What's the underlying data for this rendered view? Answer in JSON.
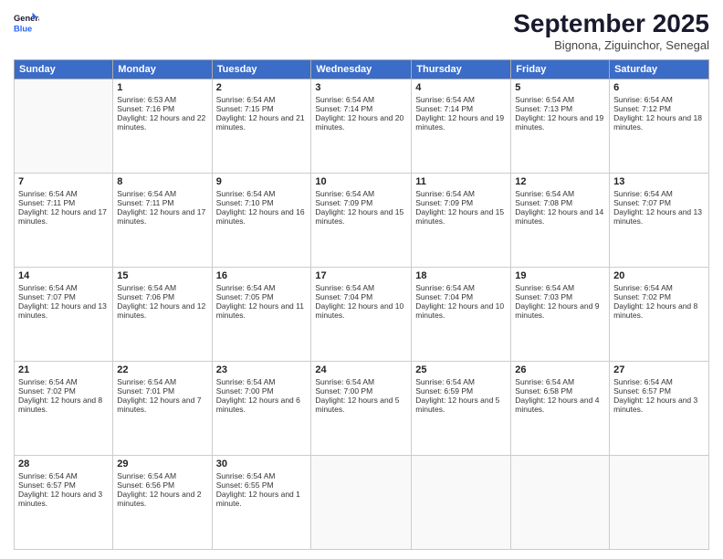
{
  "header": {
    "logo_line1": "General",
    "logo_line2": "Blue",
    "month": "September 2025",
    "location": "Bignona, Ziguinchor, Senegal"
  },
  "weekdays": [
    "Sunday",
    "Monday",
    "Tuesday",
    "Wednesday",
    "Thursday",
    "Friday",
    "Saturday"
  ],
  "weeks": [
    [
      {
        "day": "",
        "sunrise": "",
        "sunset": "",
        "daylight": ""
      },
      {
        "day": "1",
        "sunrise": "Sunrise: 6:53 AM",
        "sunset": "Sunset: 7:16 PM",
        "daylight": "Daylight: 12 hours and 22 minutes."
      },
      {
        "day": "2",
        "sunrise": "Sunrise: 6:54 AM",
        "sunset": "Sunset: 7:15 PM",
        "daylight": "Daylight: 12 hours and 21 minutes."
      },
      {
        "day": "3",
        "sunrise": "Sunrise: 6:54 AM",
        "sunset": "Sunset: 7:14 PM",
        "daylight": "Daylight: 12 hours and 20 minutes."
      },
      {
        "day": "4",
        "sunrise": "Sunrise: 6:54 AM",
        "sunset": "Sunset: 7:14 PM",
        "daylight": "Daylight: 12 hours and 19 minutes."
      },
      {
        "day": "5",
        "sunrise": "Sunrise: 6:54 AM",
        "sunset": "Sunset: 7:13 PM",
        "daylight": "Daylight: 12 hours and 19 minutes."
      },
      {
        "day": "6",
        "sunrise": "Sunrise: 6:54 AM",
        "sunset": "Sunset: 7:12 PM",
        "daylight": "Daylight: 12 hours and 18 minutes."
      }
    ],
    [
      {
        "day": "7",
        "sunrise": "Sunrise: 6:54 AM",
        "sunset": "Sunset: 7:11 PM",
        "daylight": "Daylight: 12 hours and 17 minutes."
      },
      {
        "day": "8",
        "sunrise": "Sunrise: 6:54 AM",
        "sunset": "Sunset: 7:11 PM",
        "daylight": "Daylight: 12 hours and 17 minutes."
      },
      {
        "day": "9",
        "sunrise": "Sunrise: 6:54 AM",
        "sunset": "Sunset: 7:10 PM",
        "daylight": "Daylight: 12 hours and 16 minutes."
      },
      {
        "day": "10",
        "sunrise": "Sunrise: 6:54 AM",
        "sunset": "Sunset: 7:09 PM",
        "daylight": "Daylight: 12 hours and 15 minutes."
      },
      {
        "day": "11",
        "sunrise": "Sunrise: 6:54 AM",
        "sunset": "Sunset: 7:09 PM",
        "daylight": "Daylight: 12 hours and 15 minutes."
      },
      {
        "day": "12",
        "sunrise": "Sunrise: 6:54 AM",
        "sunset": "Sunset: 7:08 PM",
        "daylight": "Daylight: 12 hours and 14 minutes."
      },
      {
        "day": "13",
        "sunrise": "Sunrise: 6:54 AM",
        "sunset": "Sunset: 7:07 PM",
        "daylight": "Daylight: 12 hours and 13 minutes."
      }
    ],
    [
      {
        "day": "14",
        "sunrise": "Sunrise: 6:54 AM",
        "sunset": "Sunset: 7:07 PM",
        "daylight": "Daylight: 12 hours and 13 minutes."
      },
      {
        "day": "15",
        "sunrise": "Sunrise: 6:54 AM",
        "sunset": "Sunset: 7:06 PM",
        "daylight": "Daylight: 12 hours and 12 minutes."
      },
      {
        "day": "16",
        "sunrise": "Sunrise: 6:54 AM",
        "sunset": "Sunset: 7:05 PM",
        "daylight": "Daylight: 12 hours and 11 minutes."
      },
      {
        "day": "17",
        "sunrise": "Sunrise: 6:54 AM",
        "sunset": "Sunset: 7:04 PM",
        "daylight": "Daylight: 12 hours and 10 minutes."
      },
      {
        "day": "18",
        "sunrise": "Sunrise: 6:54 AM",
        "sunset": "Sunset: 7:04 PM",
        "daylight": "Daylight: 12 hours and 10 minutes."
      },
      {
        "day": "19",
        "sunrise": "Sunrise: 6:54 AM",
        "sunset": "Sunset: 7:03 PM",
        "daylight": "Daylight: 12 hours and 9 minutes."
      },
      {
        "day": "20",
        "sunrise": "Sunrise: 6:54 AM",
        "sunset": "Sunset: 7:02 PM",
        "daylight": "Daylight: 12 hours and 8 minutes."
      }
    ],
    [
      {
        "day": "21",
        "sunrise": "Sunrise: 6:54 AM",
        "sunset": "Sunset: 7:02 PM",
        "daylight": "Daylight: 12 hours and 8 minutes."
      },
      {
        "day": "22",
        "sunrise": "Sunrise: 6:54 AM",
        "sunset": "Sunset: 7:01 PM",
        "daylight": "Daylight: 12 hours and 7 minutes."
      },
      {
        "day": "23",
        "sunrise": "Sunrise: 6:54 AM",
        "sunset": "Sunset: 7:00 PM",
        "daylight": "Daylight: 12 hours and 6 minutes."
      },
      {
        "day": "24",
        "sunrise": "Sunrise: 6:54 AM",
        "sunset": "Sunset: 7:00 PM",
        "daylight": "Daylight: 12 hours and 5 minutes."
      },
      {
        "day": "25",
        "sunrise": "Sunrise: 6:54 AM",
        "sunset": "Sunset: 6:59 PM",
        "daylight": "Daylight: 12 hours and 5 minutes."
      },
      {
        "day": "26",
        "sunrise": "Sunrise: 6:54 AM",
        "sunset": "Sunset: 6:58 PM",
        "daylight": "Daylight: 12 hours and 4 minutes."
      },
      {
        "day": "27",
        "sunrise": "Sunrise: 6:54 AM",
        "sunset": "Sunset: 6:57 PM",
        "daylight": "Daylight: 12 hours and 3 minutes."
      }
    ],
    [
      {
        "day": "28",
        "sunrise": "Sunrise: 6:54 AM",
        "sunset": "Sunset: 6:57 PM",
        "daylight": "Daylight: 12 hours and 3 minutes."
      },
      {
        "day": "29",
        "sunrise": "Sunrise: 6:54 AM",
        "sunset": "Sunset: 6:56 PM",
        "daylight": "Daylight: 12 hours and 2 minutes."
      },
      {
        "day": "30",
        "sunrise": "Sunrise: 6:54 AM",
        "sunset": "Sunset: 6:55 PM",
        "daylight": "Daylight: 12 hours and 1 minute."
      },
      {
        "day": "",
        "sunrise": "",
        "sunset": "",
        "daylight": ""
      },
      {
        "day": "",
        "sunrise": "",
        "sunset": "",
        "daylight": ""
      },
      {
        "day": "",
        "sunrise": "",
        "sunset": "",
        "daylight": ""
      },
      {
        "day": "",
        "sunrise": "",
        "sunset": "",
        "daylight": ""
      }
    ]
  ]
}
